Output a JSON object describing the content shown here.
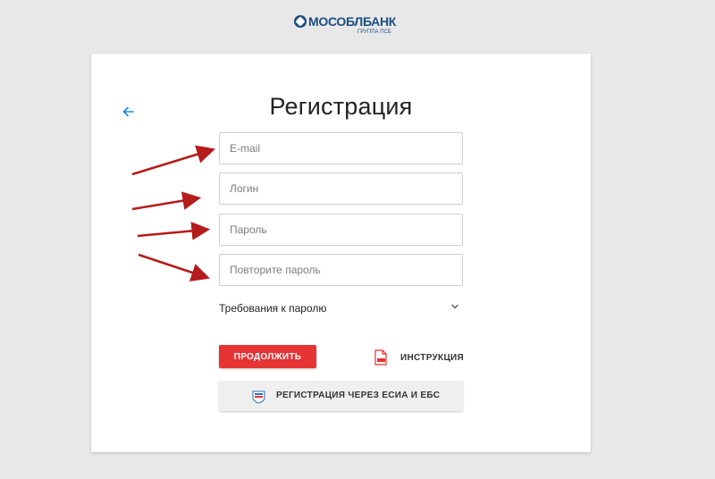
{
  "logo": {
    "brand_name": "МОСОБЛБАНК",
    "subtitle": "ГРУППА ПСБ"
  },
  "form": {
    "title": "Регистрация",
    "email_placeholder": "E-mail",
    "login_placeholder": "Логин",
    "password_placeholder": "Пароль",
    "repeat_password_placeholder": "Повторите пароль",
    "password_requirements_label": "Требования к паролю",
    "continue_label": "ПРОДОЛЖИТЬ",
    "instruction_label": "ИНСТРУКЦИЯ",
    "esia_label": "РЕГИСТРАЦИЯ ЧЕРЕЗ ЕСИА И ЕБС"
  },
  "icons": {
    "back": "arrow-left-icon",
    "chevron": "chevron-down-icon",
    "pdf": "pdf-file-icon",
    "esia": "gosuslugi-icon"
  },
  "colors": {
    "primary_red": "#e63333",
    "link_blue": "#1e88e5",
    "brand_blue": "#1d4d84",
    "annotation_arrow": "#b51c1c"
  }
}
